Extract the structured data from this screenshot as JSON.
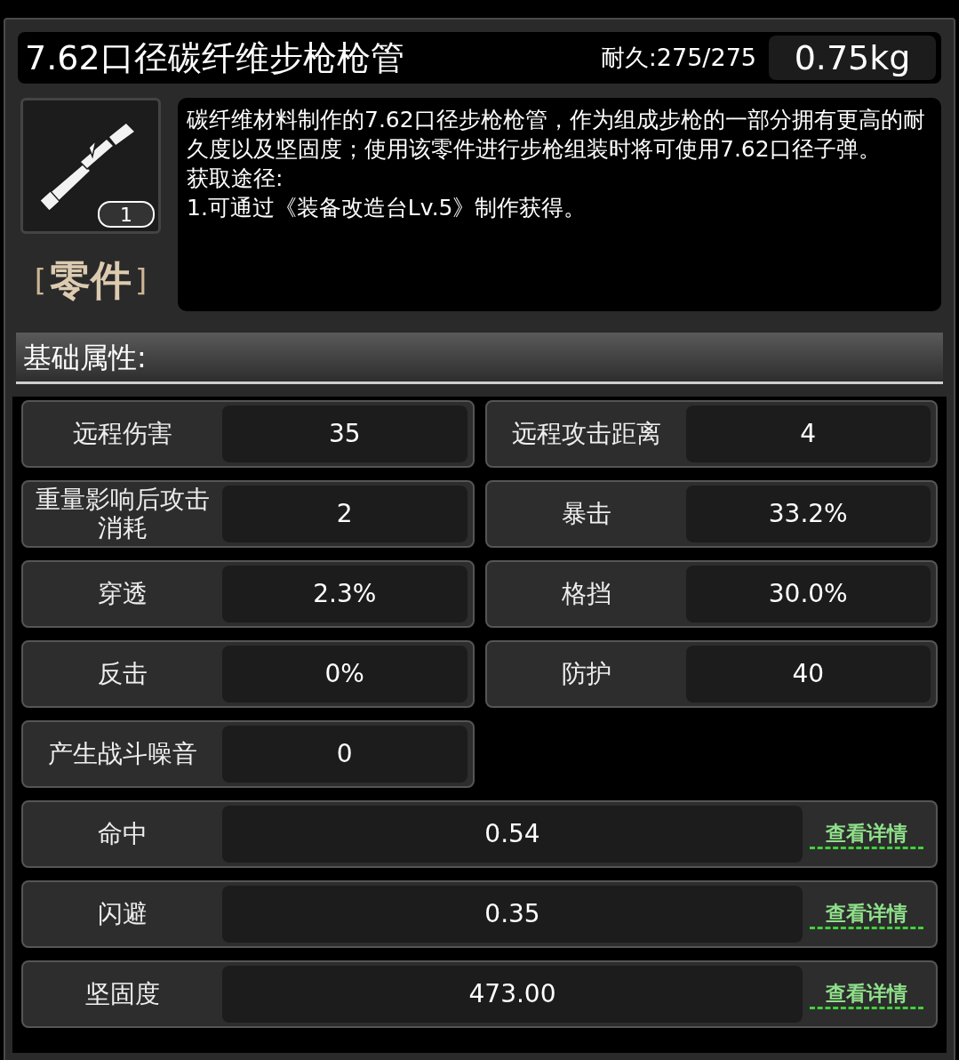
{
  "item": {
    "name": "7.62口径碳纤维步枪枪管",
    "durability": "耐久:275/275",
    "weight": "0.75kg",
    "count": "1",
    "category_open": "[",
    "category": "零件",
    "category_close": "]"
  },
  "description": [
    "碳纤维材料制作的7.62口径步枪枪管，作为组成步枪的一部分拥有更高的耐久度以及坚固度；使用该零件进行步枪组装时将可使用7.62口径子弹。",
    "获取途径:",
    "1.可通过《装备改造台Lv.5》制作获得。"
  ],
  "section_title": "基础属性:",
  "stats": [
    {
      "kind": "half",
      "label": "远程伤害",
      "value": "35"
    },
    {
      "kind": "half",
      "label": "远程攻击距离",
      "value": "4"
    },
    {
      "kind": "half",
      "label": "重量影响后攻击消耗",
      "value": "2"
    },
    {
      "kind": "half",
      "label": "暴击",
      "value": "33.2%"
    },
    {
      "kind": "half",
      "label": "穿透",
      "value": "2.3%"
    },
    {
      "kind": "half",
      "label": "格挡",
      "value": "30.0%"
    },
    {
      "kind": "half",
      "label": "反击",
      "value": "0%"
    },
    {
      "kind": "half",
      "label": "防护",
      "value": "40"
    },
    {
      "kind": "half",
      "label": "产生战斗噪音",
      "value": "0"
    },
    {
      "kind": "wide",
      "label": "命中",
      "value": "0.54",
      "link": "查看详情"
    },
    {
      "kind": "wide",
      "label": "闪避",
      "value": "0.35",
      "link": "查看详情"
    },
    {
      "kind": "wide",
      "label": "坚固度",
      "value": "473.00",
      "link": "查看详情"
    }
  ]
}
